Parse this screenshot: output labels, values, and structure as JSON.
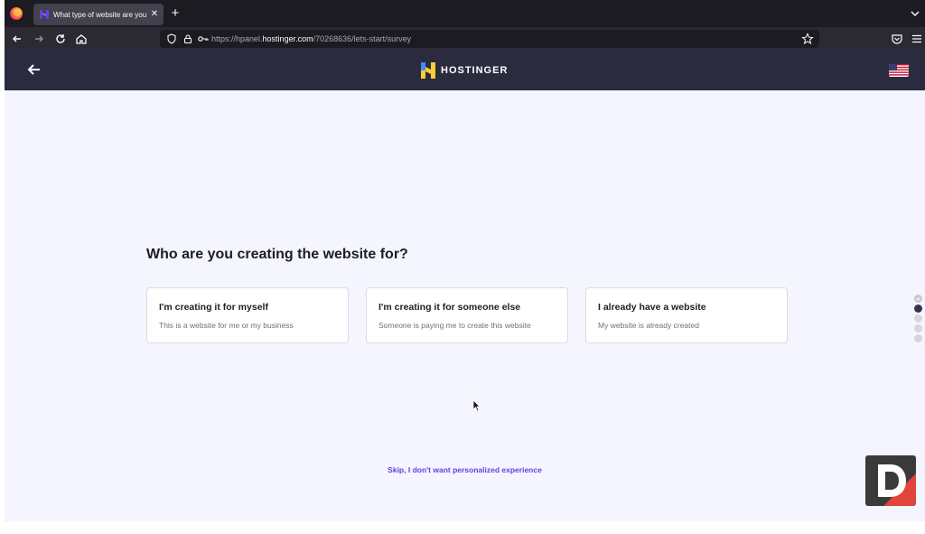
{
  "browser": {
    "tab": {
      "title": "What type of website are you c"
    },
    "url": {
      "prefix": "https://hpanel.",
      "domain": "hostinger.com",
      "path": "/70268636/lets-start/survey"
    }
  },
  "header": {
    "logo_text": "HOSTINGER",
    "language": "en-US"
  },
  "survey": {
    "question": "Who are you creating the website for?",
    "options": [
      {
        "title": "I'm creating it for myself",
        "description": "This is a website for me or my business"
      },
      {
        "title": "I'm creating it for someone else",
        "description": "Someone is paying me to create this website"
      },
      {
        "title": "I already have a website",
        "description": "My website is already created"
      }
    ],
    "skip_label": "Skip, I don't want personalized experience",
    "progress": {
      "total_steps": 5,
      "completed_steps": 1,
      "current_step": 2
    }
  },
  "colors": {
    "header_bg": "#2b2b40",
    "page_bg": "#f4f5ff",
    "accent": "#673de6",
    "logo_yellow": "#ffcd35",
    "logo_blue": "#3f8cff"
  },
  "icons": [
    "firefox-logo-icon",
    "close-icon",
    "plus-icon",
    "chevron-down-icon",
    "back-arrow-icon",
    "forward-arrow-icon",
    "reload-icon",
    "home-icon",
    "shield-icon",
    "lock-icon",
    "key-icon",
    "star-icon",
    "pocket-icon",
    "menu-icon",
    "us-flag-icon",
    "check-icon"
  ]
}
